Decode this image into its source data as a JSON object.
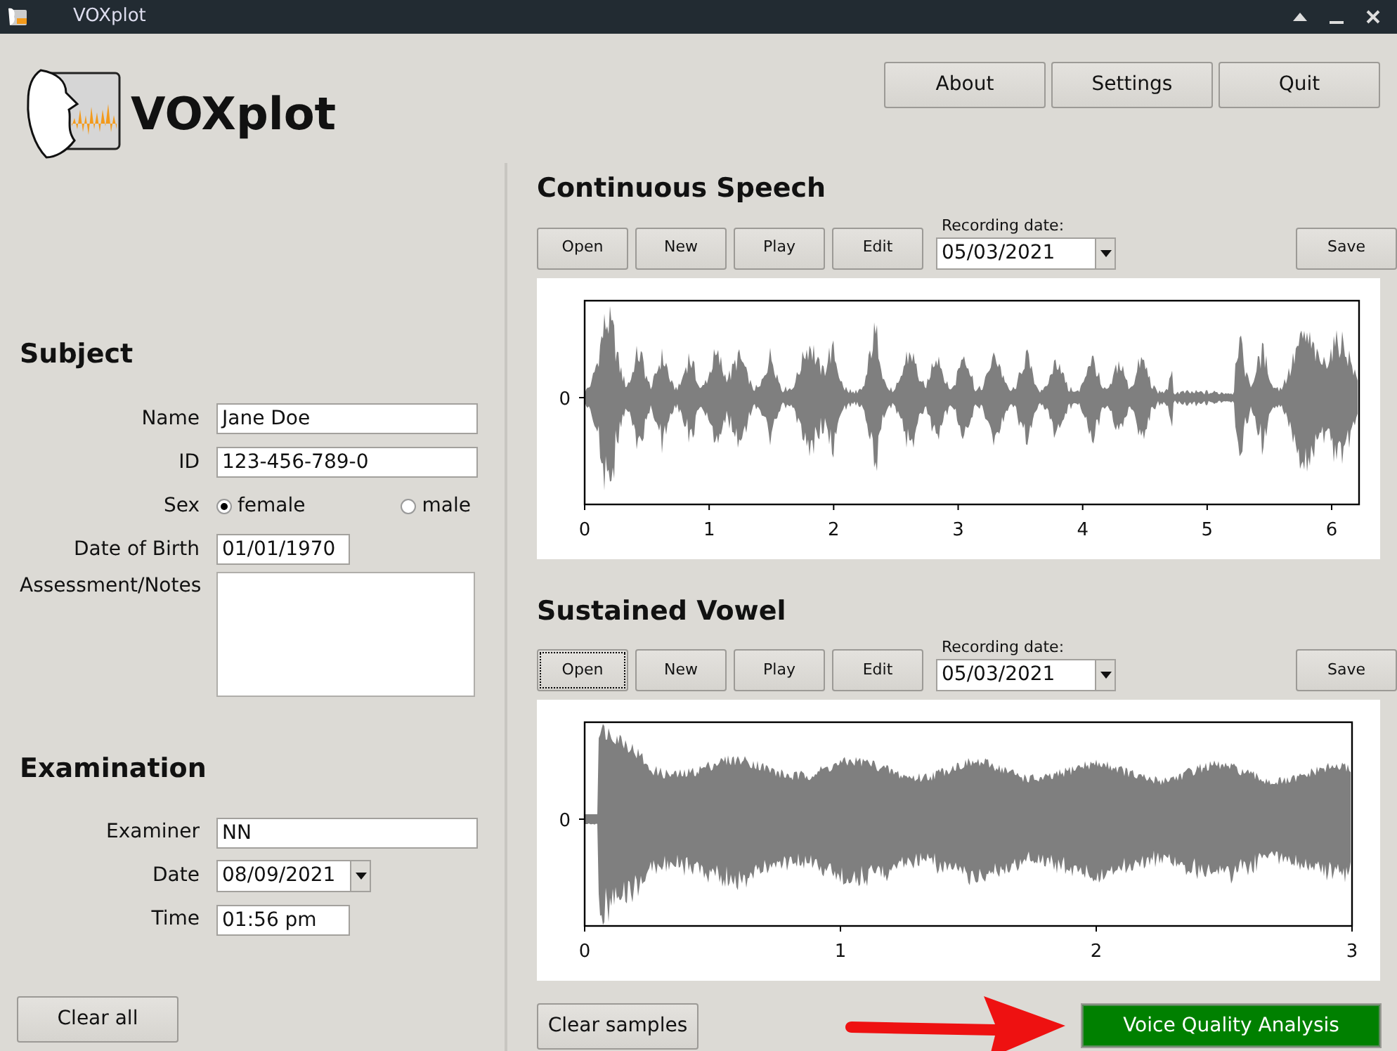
{
  "window": {
    "title": "VOXplot"
  },
  "app": {
    "name": "VOXplot"
  },
  "top_buttons": [
    "About",
    "Settings",
    "Quit"
  ],
  "subject": {
    "heading": "Subject",
    "fields": [
      {
        "kind": "text",
        "label": "Name",
        "value": "Jane Doe"
      },
      {
        "kind": "text",
        "label": "ID",
        "value": "123-456-789-0"
      },
      {
        "kind": "radio",
        "label": "Sex",
        "options": [
          {
            "label": "female",
            "selected": true
          },
          {
            "label": "male",
            "selected": false
          }
        ]
      },
      {
        "kind": "short",
        "label": "Date of Birth",
        "value": "01/01/1970"
      },
      {
        "kind": "textarea",
        "label": "Assessment/Notes"
      }
    ]
  },
  "examination": {
    "heading": "Examination",
    "fields": [
      {
        "kind": "text",
        "label": "Examiner",
        "value": "NN"
      },
      {
        "kind": "date",
        "label": "Date",
        "value": "08/09/2021"
      },
      {
        "kind": "short",
        "label": "Time",
        "value": "01:56 pm"
      }
    ]
  },
  "clear_all": "Clear all",
  "recordings": [
    {
      "kind": "speech",
      "title": "Continuous Speech",
      "buttons": [
        {
          "label": "Open",
          "focused": false
        },
        {
          "label": "New",
          "focused": false
        },
        {
          "label": "Play",
          "focused": false
        },
        {
          "label": "Edit",
          "focused": false
        }
      ],
      "date_label": "Recording date:",
      "date": "05/03/2021",
      "save": "Save",
      "y_tick": "0",
      "x_ticks": [
        "0",
        "1",
        "2",
        "3",
        "4",
        "5",
        "6"
      ]
    },
    {
      "kind": "vowel",
      "title": "Sustained Vowel",
      "buttons": [
        {
          "label": "Open",
          "focused": true
        },
        {
          "label": "New",
          "focused": false
        },
        {
          "label": "Play",
          "focused": false
        },
        {
          "label": "Edit",
          "focused": false
        }
      ],
      "date_label": "Recording date:",
      "date": "05/03/2021",
      "save": "Save",
      "y_tick": "0",
      "x_ticks": [
        "0",
        "1",
        "2",
        "3"
      ]
    }
  ],
  "clear_samples": "Clear samples",
  "analyze": "Voice Quality Analysis"
}
